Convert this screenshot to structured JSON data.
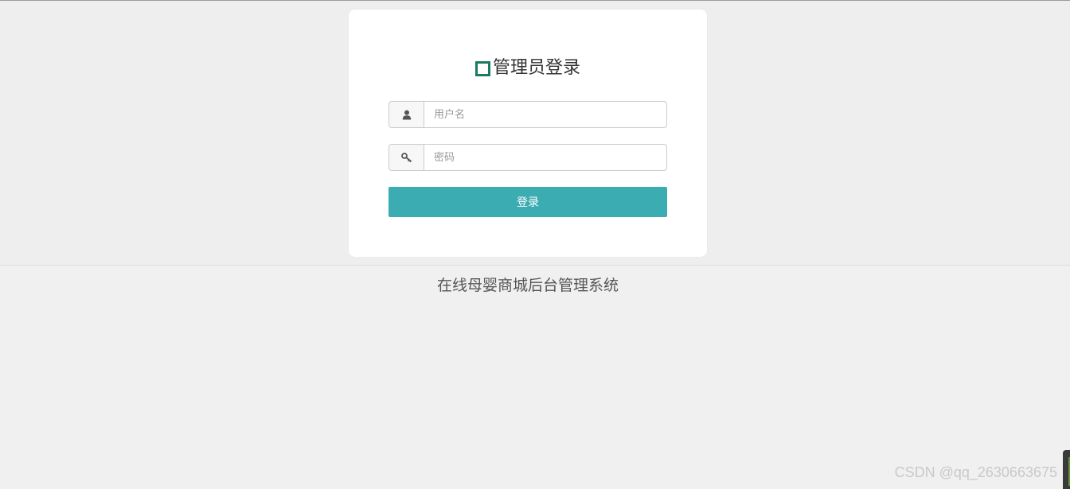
{
  "login": {
    "title": "管理员登录",
    "username_placeholder": "用户名",
    "password_placeholder": "密码",
    "submit_label": "登录"
  },
  "footer": {
    "system_name": "在线母婴商城后台管理系统"
  },
  "watermark": {
    "text": "CSDN @qq_2630663675"
  },
  "icons": {
    "title": "square-icon",
    "username": "user-icon",
    "password": "key-icon"
  },
  "colors": {
    "accent": "#3aacb2",
    "title_icon": "#1a7a63",
    "background": "#eeeeee"
  }
}
